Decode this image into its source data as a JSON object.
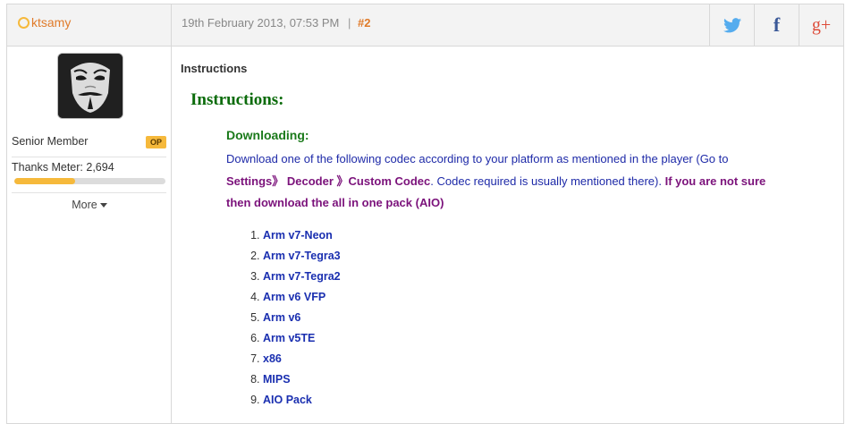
{
  "post": {
    "username": "ktsamy",
    "date": "19th February 2013, 07:53 PM",
    "separator": "|",
    "post_number": "#2"
  },
  "share": {
    "twitter_icon": "twitter-icon",
    "facebook_icon": "facebook-icon",
    "facebook_glyph": "f",
    "gplus_icon": "google-plus-icon",
    "gplus_glyph": "g+"
  },
  "user": {
    "rank": "Senior Member",
    "op_badge": "OP",
    "thanks_meter_label": "Thanks Meter: 2,694",
    "thanks_meter_level": 0.4,
    "more_label": "More"
  },
  "content": {
    "title": "Instructions",
    "heading": "Instructions:",
    "subheading": "Downloading:",
    "text_1": "Download one of the following codec according to your platform as mentioned in the player (Go to ",
    "path": "Settings》 Decoder 》Custom Codec",
    "text_2": ". Codec required is usually mentioned there). ",
    "note": "If you are not sure then download the all in one pack (AIO)",
    "codecs": [
      "Arm v7-Neon",
      "Arm v7-Tegra3",
      "Arm v7-Tegra2",
      "Arm v6 VFP",
      "Arm v6",
      "Arm v5TE",
      "x86",
      "MIPS",
      "AIO Pack"
    ]
  },
  "colors": {
    "accent_orange": "#e07b2a",
    "meter_yellow": "#f6b93b",
    "heading_green": "#0b6b0b",
    "link_blue": "#1a2fb0",
    "highlight_purple": "#7b127b"
  }
}
